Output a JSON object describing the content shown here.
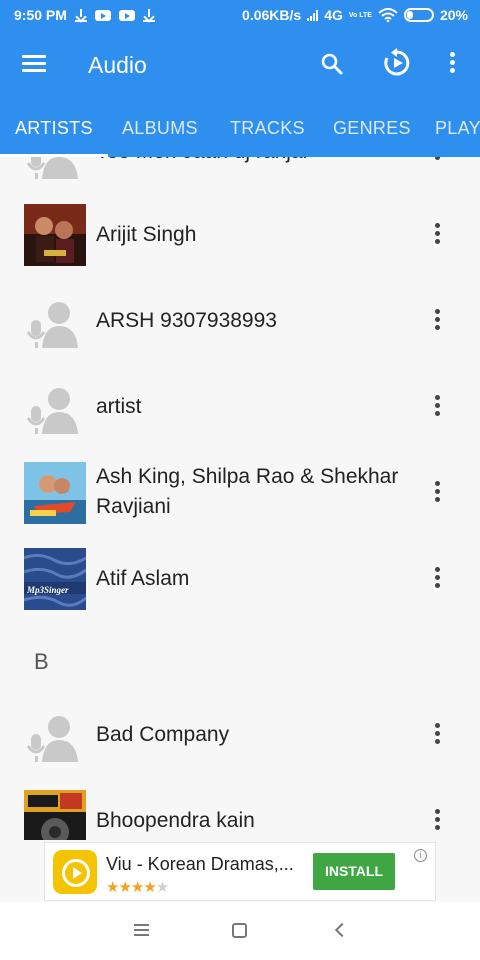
{
  "status_bar": {
    "time": "9:50 PM",
    "network_speed": "0.06KB/s",
    "network_type": "4G",
    "volte": "Vo LTE",
    "battery": "20%"
  },
  "app_bar": {
    "title": "Audio",
    "icons": [
      "menu-icon",
      "search-icon",
      "refresh-icon",
      "more-vert-icon"
    ]
  },
  "tabs": [
    {
      "label": "ARTISTS",
      "active": true
    },
    {
      "label": "ALBUMS",
      "active": false
    },
    {
      "label": "TRACKS",
      "active": false
    },
    {
      "label": "GENRES",
      "active": false
    },
    {
      "label": "PLAY",
      "active": false
    }
  ],
  "list": {
    "partial_top_item": "Teo Meri Jaan dj ranjal",
    "items": [
      {
        "name": "Arijit Singh",
        "thumb": "album-art"
      },
      {
        "name": "ARSH 9307938993",
        "thumb": "default-artist-icon"
      },
      {
        "name": "artist",
        "thumb": "default-artist-icon"
      },
      {
        "name": "Ash King, Shilpa Rao & Shekhar Ravjiani",
        "thumb": "album-art"
      },
      {
        "name": "Atif Aslam",
        "thumb": "album-art",
        "thumb_text": "Mp3Singer"
      }
    ],
    "section_b": "B",
    "items_b": [
      {
        "name": "Bad Company",
        "thumb": "default-artist-icon"
      },
      {
        "name": "Bhoopendra kain",
        "thumb": "album-art"
      }
    ]
  },
  "ad": {
    "title": "Viu - Korean Dramas,...",
    "rating": 4,
    "install_label": "INSTALL",
    "info_glyph": "i"
  },
  "colors": {
    "primary": "#2f8fee",
    "install": "#3ea744",
    "star": "#f4a21c"
  }
}
